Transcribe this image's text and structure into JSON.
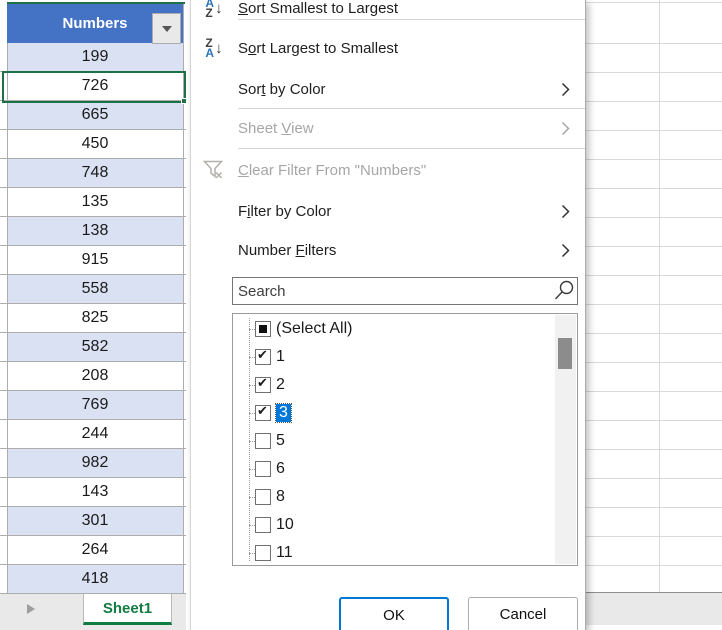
{
  "colors": {
    "header_bg": "#4472C4",
    "band_row": "#D9E1F2",
    "active_cell_border": "#1E7145",
    "sheet_tab_green": "#107C41",
    "selection_blue": "#0078D7",
    "ok_border_blue": "#0078D4",
    "sort_letter_blue": "#2E75B6",
    "disabled_gray": "#A6A6A6"
  },
  "table": {
    "header": "Numbers",
    "values": [
      "199",
      "726",
      "665",
      "450",
      "748",
      "135",
      "138",
      "915",
      "558",
      "825",
      "582",
      "208",
      "769",
      "244",
      "982",
      "143",
      "301",
      "264",
      "418"
    ],
    "active_index": 1,
    "sheet_tab": "Sheet1"
  },
  "menu": {
    "items": [
      {
        "label": "Sort Smallest to Largest",
        "accel": 0,
        "icon": "sort-az",
        "disabled": false,
        "submenu": false
      },
      {
        "label": "Sort Largest to Smallest",
        "accel": 1,
        "icon": "sort-za",
        "disabled": false,
        "submenu": false
      },
      {
        "label": "Sort by Color",
        "accel": 3,
        "icon": null,
        "disabled": false,
        "submenu": true
      },
      {
        "label": "Sheet View",
        "accel": 6,
        "icon": null,
        "disabled": true,
        "submenu": true
      },
      {
        "label": "Clear Filter From \"Numbers\"",
        "accel": 0,
        "icon": "clear-filter",
        "disabled": true,
        "submenu": false
      },
      {
        "label": "Filter by Color",
        "accel": 1,
        "icon": null,
        "disabled": false,
        "submenu": true
      },
      {
        "label": "Number Filters",
        "accel": 7,
        "icon": null,
        "disabled": false,
        "submenu": true
      }
    ],
    "search_placeholder": "Search",
    "list": {
      "items": [
        {
          "label": "(Select All)",
          "state": "indeterminate",
          "selected": false
        },
        {
          "label": "1",
          "state": "checked",
          "selected": false
        },
        {
          "label": "2",
          "state": "checked",
          "selected": false
        },
        {
          "label": "3",
          "state": "checked",
          "selected": true
        },
        {
          "label": "5",
          "state": "unchecked",
          "selected": false
        },
        {
          "label": "6",
          "state": "unchecked",
          "selected": false
        },
        {
          "label": "8",
          "state": "unchecked",
          "selected": false
        },
        {
          "label": "10",
          "state": "unchecked",
          "selected": false
        },
        {
          "label": "11",
          "state": "unchecked",
          "selected": false
        }
      ]
    },
    "buttons": {
      "ok": "OK",
      "cancel": "Cancel"
    }
  }
}
